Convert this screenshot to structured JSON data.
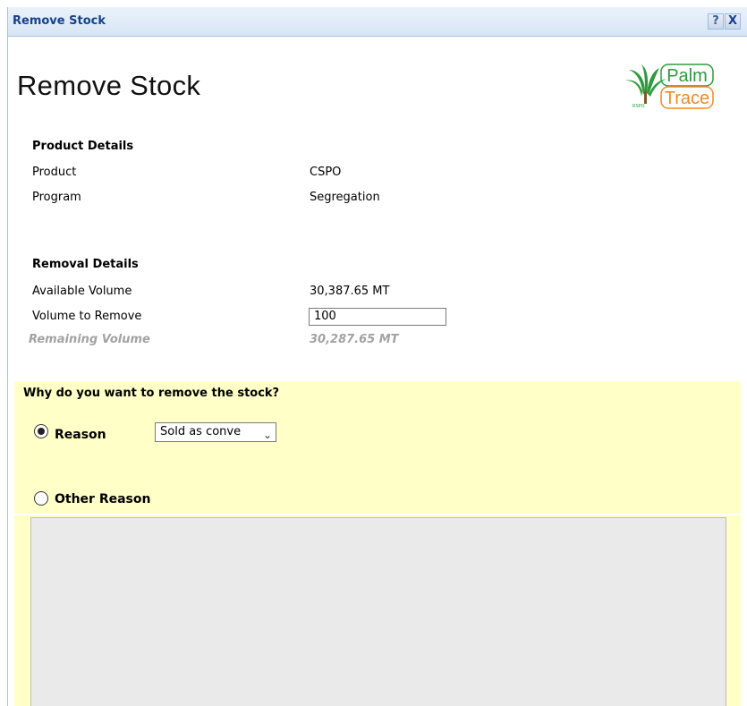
{
  "window": {
    "title": "Remove Stock",
    "help_label": "?",
    "close_label": "X"
  },
  "page_title": "Remove Stock",
  "logo": {
    "line1": "Palm",
    "line2": "Trace",
    "small": "RSPO"
  },
  "product_details": {
    "heading": "Product Details",
    "rows": [
      {
        "label": "Product",
        "value": "CSPO"
      },
      {
        "label": "Program",
        "value": "Segregation"
      }
    ]
  },
  "removal_details": {
    "heading": "Removal Details",
    "available_label": "Available Volume",
    "available_value": "30,387.65 MT",
    "remove_label": "Volume to Remove",
    "remove_value": "100",
    "remaining_label": "Remaining Volume",
    "remaining_value": "30,287.65 MT"
  },
  "reason_section": {
    "question": "Why do you want to remove the stock?",
    "reason_label": "Reason",
    "reason_selected": "Sold as conve",
    "other_label": "Other Reason",
    "other_text": ""
  }
}
